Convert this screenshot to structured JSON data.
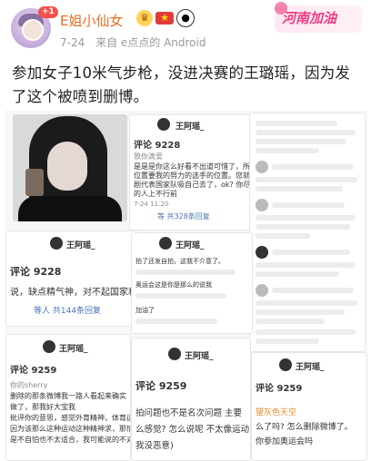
{
  "author": {
    "name": "E姐小仙女",
    "badge": "+1",
    "emojis": [
      "crown-emoji",
      "china-flag-emoji",
      "panda-emoji"
    ],
    "date": "7-24",
    "source": "来自 e点点的 Android"
  },
  "watermark": "河南加油",
  "post": {
    "text": "参加女子10米气步枪，没进决赛的王璐瑶，因为发了这个被喷到删博。"
  },
  "collage": {
    "card1": {
      "username": "王阿瑶_",
      "comment_title": "评论 9228",
      "lines": [
        "致你滴爱",
        "是是是你这么好看不出道可惜了，所以到上",
        "位置要我的努力的选手的位置。您就安心出",
        "剧代表国家队吸自己去了，ok? 你尽了。让",
        "的人上不行前"
      ],
      "date": "7-24 11:20",
      "reply": "等 共328条回复"
    },
    "card2": {
      "header": "评论 9228",
      "line": "说，缺点精气神，对不起国家和",
      "replies": "等人 共144条回复"
    },
    "card3": {
      "username": "王阿瑶_",
      "header": "评论 9259",
      "lines": [
        "删除的那条微博我一路人看起来确实",
        "做了，那我好大宝我",
        "批评你的意思，感觉外育精神，体育运",
        "因为该那么这种运动这种精神求，那怕没",
        "是不自怕也不太适合，我可能说的不对"
      ],
      "comment_author": "你的sherry"
    },
    "card4": {
      "header": "评论 9259",
      "lines": [
        "拍问题也不是名次问题 主要",
        "么感觉? 怎么说呢 不太像运动",
        "我没恶意)"
      ]
    },
    "card5": {
      "username": "王阿瑶_",
      "lines": [
        "一个不要吹了吧 这是我的",
        "打了什么么"
      ],
      "comments": [
        "拍了还发自拍，这我不介意了。",
        "奥运会这是你是那么的说我",
        "加油了"
      ]
    },
    "card6": {
      "username": "王阿瑶_",
      "top_comment": "评论 9259",
      "lines": [
        "望灰色天空",
        "么了吗? 怎么删除微博了。 ",
        "你参加奥运会吗"
      ]
    }
  }
}
